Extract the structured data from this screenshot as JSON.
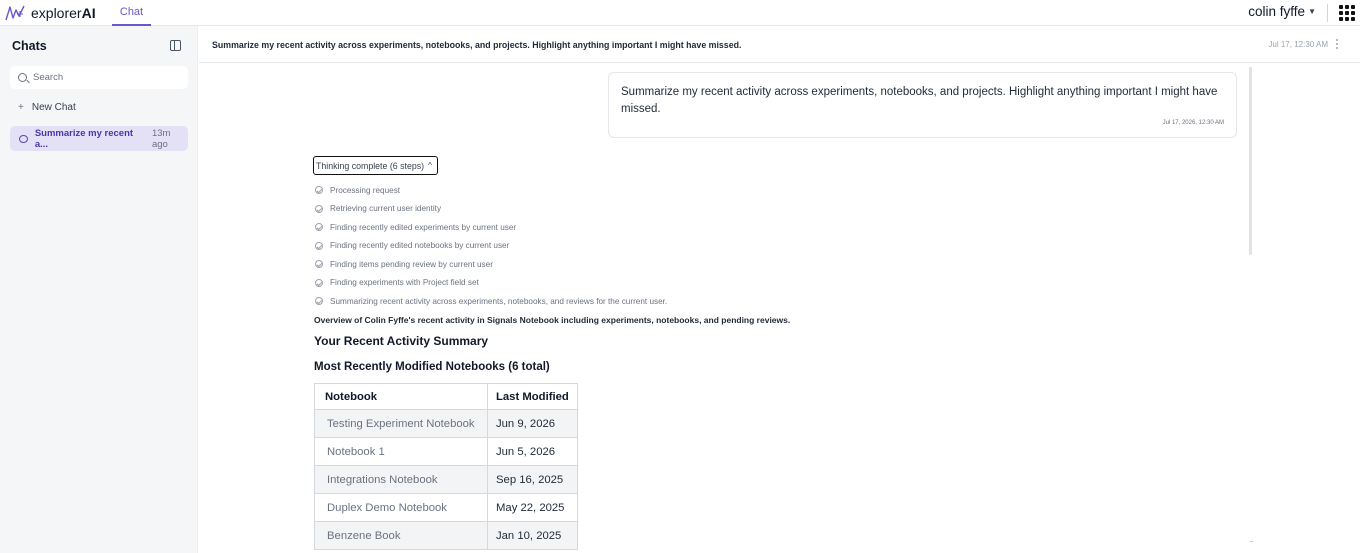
{
  "app": {
    "brand_prefix": "explorer",
    "brand_suffix": "AI",
    "active_tab": "Chat"
  },
  "user": {
    "name": "colin fyffe"
  },
  "sidebar": {
    "heading": "Chats",
    "search_placeholder": "Search",
    "new_chat_label": "New Chat",
    "chats": [
      {
        "title": "Summarize my recent a...",
        "time": "13m ago"
      }
    ]
  },
  "conversation": {
    "title": "Summarize my recent activity across experiments, notebooks, and projects. Highlight anything important I might have missed.",
    "header_timestamp": "Jul 17, 12:30 AM",
    "user_message": "Summarize my recent activity across experiments, notebooks, and projects. Highlight anything important I might have missed.",
    "user_message_timestamp": "Jul 17, 2026, 12:30 AM",
    "thinking_label": "Thinking complete (6 steps)",
    "steps": [
      "Processing request",
      "Retrieving current user identity",
      "Finding recently edited experiments by current user",
      "Finding recently edited notebooks by current user",
      "Finding items pending review by current user",
      "Finding experiments with Project field set",
      "Summarizing recent activity across experiments, notebooks, and reviews for the current user."
    ],
    "overview": "Overview of Colin Fyffe's recent activity in Signals Notebook including experiments, notebooks, and pending reviews.",
    "summary_heading": "Your Recent Activity Summary",
    "notebooks_heading": "Most Recently Modified Notebooks (6 total)",
    "table": {
      "columns": [
        "Notebook",
        "Last Modified"
      ],
      "rows": [
        [
          "Testing Experiment Notebook",
          "Jun 9, 2026"
        ],
        [
          "Notebook 1",
          "Jun 5, 2026"
        ],
        [
          "Integrations Notebook",
          "Sep 16, 2025"
        ],
        [
          "Duplex Demo Notebook",
          "May 22, 2025"
        ],
        [
          "Benzene Book",
          "Jan 10, 2025"
        ]
      ]
    }
  },
  "colors": {
    "accent": "#6b55c8",
    "selected_chat_bg": "#e4e1f6",
    "sidebar_bg": "#f5f6f8"
  }
}
